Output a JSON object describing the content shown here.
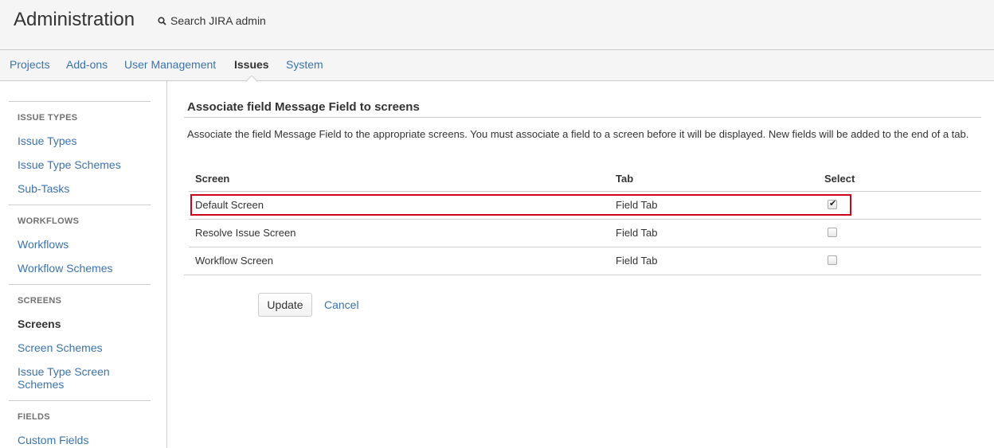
{
  "header": {
    "title": "Administration",
    "search_label": "Search JIRA admin"
  },
  "nav": {
    "tabs": [
      "Projects",
      "Add-ons",
      "User Management",
      "Issues",
      "System"
    ],
    "active": "Issues"
  },
  "sidebar": {
    "sections": [
      {
        "heading": "ISSUE TYPES",
        "items": [
          "Issue Types",
          "Issue Type Schemes",
          "Sub-Tasks"
        ]
      },
      {
        "heading": "WORKFLOWS",
        "items": [
          "Workflows",
          "Workflow Schemes"
        ]
      },
      {
        "heading": "SCREENS",
        "items": [
          "Screens",
          "Screen Schemes",
          "Issue Type Screen Schemes"
        ]
      },
      {
        "heading": "FIELDS",
        "items": [
          "Custom Fields"
        ]
      }
    ],
    "active_item": "Screens"
  },
  "main": {
    "title": "Associate field Message Field to screens",
    "description": "Associate the field Message Field to the appropriate screens. You must associate a field to a screen before it will be displayed. New fields will be added to the end of a tab.",
    "table": {
      "columns": [
        "Screen",
        "Tab",
        "Select"
      ],
      "rows": [
        {
          "screen": "Default Screen",
          "tab": "Field Tab",
          "selected": true
        },
        {
          "screen": "Resolve Issue Screen",
          "tab": "Field Tab",
          "selected": false
        },
        {
          "screen": "Workflow Screen",
          "tab": "Field Tab",
          "selected": false
        }
      ]
    },
    "update_label": "Update",
    "cancel_label": "Cancel"
  },
  "colors": {
    "link": "#3b73af",
    "highlight": "#d0021b",
    "header_bg": "#f5f5f5"
  }
}
